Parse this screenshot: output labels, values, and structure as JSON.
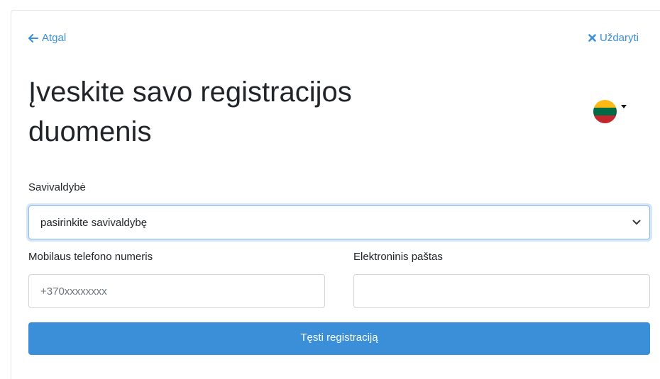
{
  "nav": {
    "back_label": "Atgal",
    "close_label": "Uždaryti"
  },
  "title": "Įveskite savo registracijos duomenis",
  "language": {
    "flag_colors": [
      "#FDB913",
      "#006A44",
      "#C1272D"
    ],
    "icon": "lithuania-flag-icon"
  },
  "form": {
    "municipality": {
      "label": "Savivaldybė",
      "selected": "pasirinkite savivaldybę"
    },
    "phone": {
      "label": "Mobilaus telefono numeris",
      "placeholder": "+370xxxxxxxx",
      "value": ""
    },
    "email": {
      "label": "Elektroninis paštas",
      "placeholder": "",
      "value": ""
    },
    "submit_label": "Tęsti registraciją"
  },
  "colors": {
    "accent": "#3b8fd9",
    "text": "#212529"
  }
}
